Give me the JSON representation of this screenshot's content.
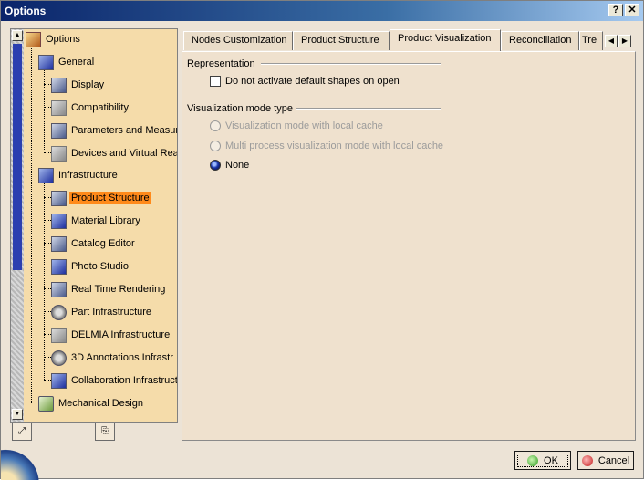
{
  "window": {
    "title": "Options",
    "help_btn": "?",
    "close_btn": "✕"
  },
  "tree": {
    "items": [
      {
        "label": "Options",
        "icon": "options-root-icon"
      },
      {
        "label": "General",
        "icon": "general-icon"
      },
      {
        "label": "Display",
        "icon": "display-icon"
      },
      {
        "label": "Compatibility",
        "icon": "compatibility-icon"
      },
      {
        "label": "Parameters and Measure",
        "icon": "parameters-icon"
      },
      {
        "label": "Devices and Virtual Reali",
        "icon": "devices-icon"
      },
      {
        "label": "Infrastructure",
        "icon": "infrastructure-icon"
      },
      {
        "label": "Product Structure",
        "icon": "product-structure-icon"
      },
      {
        "label": "Material Library",
        "icon": "material-library-icon"
      },
      {
        "label": "Catalog Editor",
        "icon": "catalog-editor-icon"
      },
      {
        "label": "Photo Studio",
        "icon": "photo-studio-icon"
      },
      {
        "label": "Real Time Rendering",
        "icon": "real-time-rendering-icon"
      },
      {
        "label": "Part Infrastructure",
        "icon": "part-infrastructure-icon"
      },
      {
        "label": "DELMIA Infrastructure",
        "icon": "delmia-icon"
      },
      {
        "label": "3D Annotations Infrastr",
        "icon": "annotations-icon"
      },
      {
        "label": "Collaboration Infrastruct",
        "icon": "collaboration-icon"
      },
      {
        "label": "Mechanical Design",
        "icon": "mechanical-design-icon"
      }
    ],
    "selected": "Product Structure"
  },
  "tabs": [
    {
      "label": "Nodes Customization"
    },
    {
      "label": "Product Structure"
    },
    {
      "label": "Product Visualization"
    },
    {
      "label": "Reconciliation"
    },
    {
      "label": "Tre"
    }
  ],
  "active_tab": "Product Visualization",
  "representation": {
    "title": "Representation",
    "checkbox_label": "Do not activate default shapes on open",
    "checked": false
  },
  "visualization": {
    "title": "Visualization mode type",
    "options": [
      {
        "label": "Visualization mode with local cache",
        "enabled": false,
        "selected": false
      },
      {
        "label": "Multi process visualization mode with local cache",
        "enabled": false,
        "selected": false
      },
      {
        "label": "None",
        "enabled": true,
        "selected": true
      }
    ]
  },
  "buttons": {
    "ok": "OK",
    "cancel": "Cancel"
  },
  "colors": {
    "selection": "#ff8a1a",
    "tree_bg": "#f5dcaa",
    "panel_bg": "#efe1ce",
    "title_bar": "#0a246a"
  }
}
